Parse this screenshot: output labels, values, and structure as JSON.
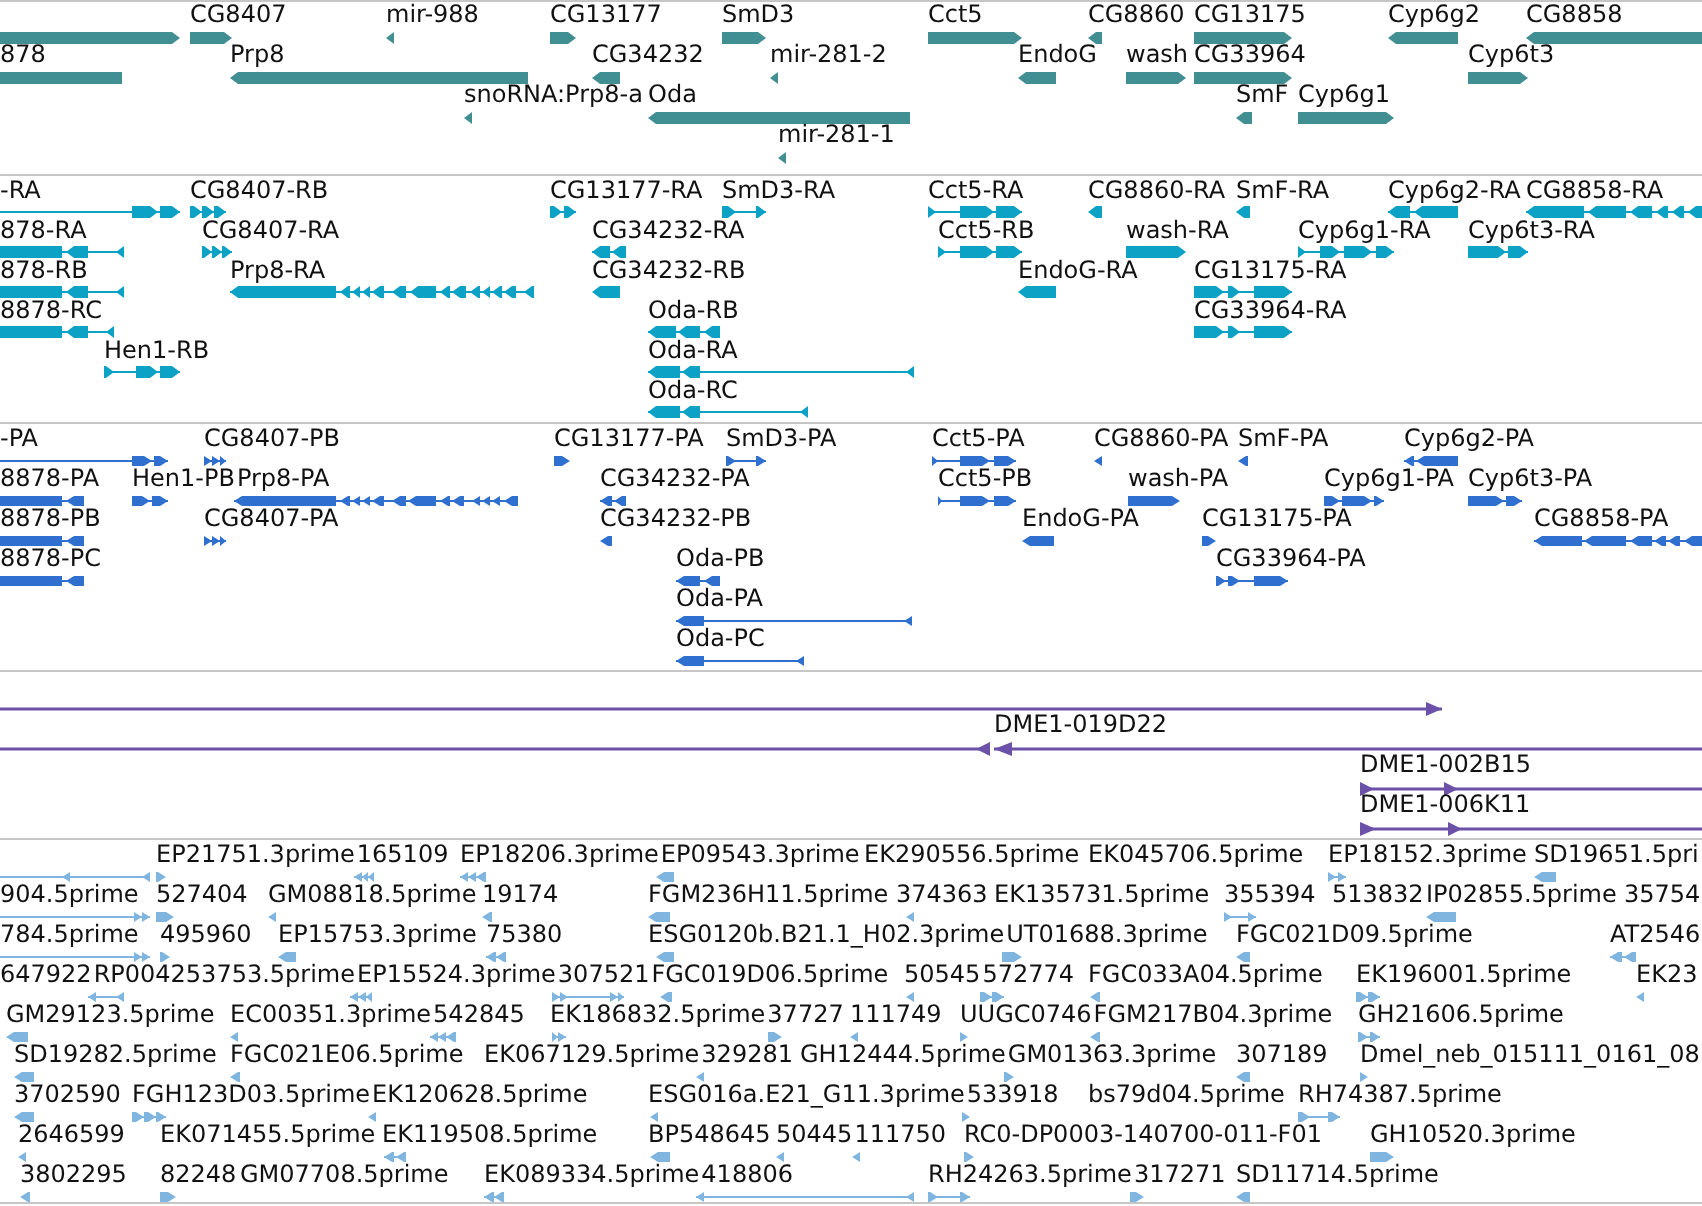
{
  "tracks": [
    {
      "kind": "gene",
      "rows": [
        {
          "features": [
            {
              "reverse": false
            },
            {
              "label": "CG8407",
              "reverse": false
            },
            {
              "label": "mir-988",
              "reverse": true
            },
            {
              "label": "CG13177",
              "reverse": false
            },
            {
              "label": "SmD3",
              "reverse": false
            },
            {
              "label": "Cct5",
              "reverse": false
            },
            {
              "label": "CG8860",
              "reverse": true
            },
            {
              "label": "CG13175",
              "reverse": false
            },
            {
              "label": "Cyp6g2",
              "reverse": true
            },
            {
              "label": "CG8858",
              "reverse": true
            }
          ]
        },
        {
          "features": [
            {
              "label": "878",
              "reverse": true
            },
            {
              "label": "Prp8",
              "reverse": true
            },
            {
              "label": "CG34232",
              "reverse": true
            },
            {
              "label": "mir-281-2",
              "reverse": true
            },
            {
              "label": "EndoG",
              "reverse": true
            },
            {
              "label": "wash",
              "reverse": false
            },
            {
              "label": "CG33964",
              "reverse": false
            },
            {
              "label": "Cyp6t3",
              "reverse": false
            }
          ]
        },
        {
          "features": [
            {
              "label": "snoRNA:Prp8-a",
              "reverse": true
            },
            {
              "label": "Oda",
              "reverse": true
            },
            {
              "label": "SmF",
              "reverse": true
            },
            {
              "label": "Cyp6g1",
              "reverse": false
            }
          ]
        },
        {
          "features": [
            {
              "label": "mir-281-1",
              "reverse": true
            }
          ]
        }
      ]
    },
    {
      "kind": "transcript",
      "rows": [
        {
          "features": [
            {
              "label": "-RA",
              "reverse": false
            },
            {
              "label": "CG8407-RB",
              "reverse": false
            },
            {
              "label": "CG13177-RA",
              "reverse": false
            },
            {
              "label": "SmD3-RA",
              "reverse": false
            },
            {
              "label": "Cct5-RA",
              "reverse": false
            },
            {
              "label": "CG8860-RA",
              "reverse": true
            },
            {
              "label": "SmF-RA",
              "reverse": true
            },
            {
              "label": "Cyp6g2-RA",
              "reverse": true
            },
            {
              "label": "CG8858-RA",
              "reverse": true
            }
          ]
        },
        {
          "features": [
            {
              "label": "878-RA",
              "reverse": true
            },
            {
              "label": "CG8407-RA",
              "reverse": false
            },
            {
              "label": "CG34232-RA",
              "reverse": true
            },
            {
              "label": "Cct5-RB",
              "reverse": false
            },
            {
              "label": "wash-RA",
              "reverse": false
            },
            {
              "label": "Cyp6g1-RA",
              "reverse": false
            },
            {
              "label": "Cyp6t3-RA",
              "reverse": false
            }
          ]
        },
        {
          "features": [
            {
              "label": "878-RB",
              "reverse": true
            },
            {
              "label": "Prp8-RA",
              "reverse": true
            },
            {
              "label": "CG34232-RB",
              "reverse": true
            },
            {
              "label": "EndoG-RA",
              "reverse": true
            },
            {
              "label": "CG13175-RA",
              "reverse": false
            }
          ]
        },
        {
          "features": [
            {
              "label": "8878-RC",
              "reverse": true
            },
            {
              "label": "Oda-RB",
              "reverse": true
            },
            {
              "label": "CG33964-RA",
              "reverse": false
            }
          ]
        },
        {
          "features": [
            {
              "label": "Hen1-RB",
              "reverse": false
            },
            {
              "label": "Oda-RA",
              "reverse": true
            }
          ]
        },
        {
          "features": [
            {
              "label": "Oda-RC",
              "reverse": true
            }
          ]
        }
      ]
    },
    {
      "kind": "protein",
      "rows": [
        {
          "features": [
            {
              "label": "-PA",
              "reverse": false
            },
            {
              "label": "CG8407-PB",
              "reverse": false
            },
            {
              "label": "CG13177-PA",
              "reverse": false
            },
            {
              "label": "SmD3-PA",
              "reverse": false
            },
            {
              "label": "Cct5-PA",
              "reverse": false
            },
            {
              "label": "CG8860-PA",
              "reverse": true
            },
            {
              "label": "SmF-PA",
              "reverse": true
            },
            {
              "label": "Cyp6g2-PA",
              "reverse": true
            }
          ]
        },
        {
          "features": [
            {
              "label": "8878-PA",
              "reverse": true
            },
            {
              "label": "Hen1-PB",
              "reverse": false
            },
            {
              "label": "Prp8-PA",
              "reverse": true
            },
            {
              "label": "CG34232-PA",
              "reverse": true
            },
            {
              "label": "Cct5-PB",
              "reverse": false
            },
            {
              "label": "wash-PA",
              "reverse": false
            },
            {
              "label": "Cyp6g1-PA",
              "reverse": false
            },
            {
              "label": "Cyp6t3-PA",
              "reverse": false
            }
          ]
        },
        {
          "features": [
            {
              "label": "8878-PB",
              "reverse": true
            },
            {
              "label": "CG8407-PA",
              "reverse": false
            },
            {
              "label": "CG34232-PB",
              "reverse": true
            },
            {
              "label": "EndoG-PA",
              "reverse": true
            },
            {
              "label": "CG13175-PA",
              "reverse": false
            },
            {
              "label": "CG8858-PA",
              "reverse": true
            }
          ]
        },
        {
          "features": [
            {
              "label": "8878-PC",
              "reverse": true
            },
            {
              "label": "Oda-PB",
              "reverse": true
            },
            {
              "label": "CG33964-PA",
              "reverse": false
            }
          ]
        },
        {
          "features": [
            {
              "label": "Oda-PA",
              "reverse": true
            }
          ]
        },
        {
          "features": [
            {
              "label": "Oda-PC",
              "reverse": true
            }
          ]
        }
      ]
    },
    {
      "kind": "clone",
      "rows": [
        {
          "features": [
            {
              "reverse": false
            }
          ]
        },
        {
          "features": [
            {
              "reverse": true
            },
            {
              "label": "DME1-019D22",
              "reverse": true
            }
          ]
        },
        {
          "features": [
            {
              "label": "DME1-002B15",
              "reverse": false
            }
          ]
        },
        {
          "features": [
            {
              "label": "DME1-006K11",
              "reverse": false
            }
          ]
        }
      ]
    },
    {
      "kind": "est",
      "rows": [
        {
          "features": [
            {
              "reverse": true
            },
            {
              "label": "EP21751.3prime",
              "reverse": false
            },
            {
              "label": "165109",
              "reverse": true
            },
            {
              "label": "EP18206.3prime",
              "reverse": true
            },
            {
              "label": "EP09543.3prime",
              "reverse": true
            },
            {
              "label": "EK290556.5prime"
            },
            {
              "label": "EK045706.5prime"
            },
            {
              "label": "EP18152.3prime",
              "reverse": false
            },
            {
              "label": "SD19651.5pri",
              "reverse": true
            }
          ]
        },
        {
          "features": [
            {
              "label": "904.5prime",
              "reverse": false
            },
            {
              "label": "527404",
              "reverse": false
            },
            {
              "label": "GM08818.5prime",
              "reverse": true
            },
            {
              "label": "19174",
              "reverse": true
            },
            {
              "label": "FGM236H11.5prime",
              "reverse": true
            },
            {
              "label": "374363",
              "reverse": true
            },
            {
              "label": "EK135731.5prime"
            },
            {
              "label": "355394",
              "reverse": false
            },
            {
              "label": "513832"
            },
            {
              "label": "IP02855.5prime",
              "reverse": true
            },
            {
              "label": "35754"
            }
          ]
        },
        {
          "features": [
            {
              "label": "784.5prime",
              "reverse": false
            },
            {
              "label": "495960",
              "reverse": false
            },
            {
              "label": "EP15753.3prime",
              "reverse": true
            },
            {
              "label": "75380",
              "reverse": true
            },
            {
              "label": "ESG0120b.B21.1_H02.3prime",
              "reverse": true
            },
            {
              "label": "UT01688.3prime",
              "reverse": false
            },
            {
              "label": "FGC021D09.5prime",
              "reverse": true
            },
            {
              "label": "AT2546",
              "reverse": true
            }
          ]
        },
        {
          "features": [
            {
              "label": "647922"
            },
            {
              "label": "RP004253753.5prime",
              "reverse": true
            },
            {
              "label": "EP15524.3prime",
              "reverse": true
            },
            {
              "label": "307521",
              "reverse": false
            },
            {
              "label": "FGC019D06.5prime",
              "reverse": true
            },
            {
              "label": "50545",
              "reverse": true
            },
            {
              "label": "572774",
              "reverse": false
            },
            {
              "label": "FGC033A04.5prime",
              "reverse": true
            },
            {
              "label": "EK196001.5prime",
              "reverse": false
            },
            {
              "label": "EK23",
              "reverse": true
            }
          ]
        },
        {
          "features": [
            {
              "label": "GM29123.5prime",
              "reverse": true
            },
            {
              "label": "EC00351.3prime",
              "reverse": true
            },
            {
              "label": "542845",
              "reverse": true
            },
            {
              "label": "EK186832.5prime",
              "reverse": false
            },
            {
              "label": "37727",
              "reverse": false
            },
            {
              "label": "111749",
              "reverse": true
            },
            {
              "label": "UUGC0746",
              "reverse": false
            },
            {
              "label": "FGM217B04.3prime",
              "reverse": true
            },
            {
              "label": "GH21606.5prime",
              "reverse": false
            }
          ]
        },
        {
          "features": [
            {
              "label": "SD19282.5prime",
              "reverse": true
            },
            {
              "label": "FGC021E06.5prime",
              "reverse": true
            },
            {
              "label": "EK067129.5prime"
            },
            {
              "label": "329281",
              "reverse": true
            },
            {
              "label": "GH12444.5prime"
            },
            {
              "label": "GM01363.3prime",
              "reverse": false
            },
            {
              "label": "307189",
              "reverse": true
            },
            {
              "label": "Dmel_neb_015111_0161_08",
              "reverse": false
            }
          ]
        },
        {
          "features": [
            {
              "label": "3702590",
              "reverse": true
            },
            {
              "label": "FGH123D03.5prime",
              "reverse": false
            },
            {
              "label": "EK120628.5prime",
              "reverse": true
            },
            {
              "label": "ESG016a.E21_G11.3prime",
              "reverse": true
            },
            {
              "label": "533918",
              "reverse": false
            },
            {
              "label": "bs79d04.5prime"
            },
            {
              "label": "RH74387.5prime",
              "reverse": false
            }
          ]
        },
        {
          "features": [
            {
              "label": "2646599",
              "reverse": true
            },
            {
              "label": "EK071455.5prime"
            },
            {
              "label": "EK119508.5prime",
              "reverse": true
            },
            {
              "label": "BP548645",
              "reverse": true
            },
            {
              "label": "50445",
              "reverse": true
            },
            {
              "label": "111750",
              "reverse": true
            },
            {
              "label": "RC0-DP0003-140700-011-F01",
              "reverse": false
            },
            {
              "label": "GH10520.3prime",
              "reverse": false
            }
          ]
        },
        {
          "features": [
            {
              "label": "3802295",
              "reverse": true
            },
            {
              "label": "82248",
              "reverse": false
            },
            {
              "label": "GM07708.5prime"
            },
            {
              "label": "EK089334.5prime",
              "reverse": true
            },
            {
              "label": "418806",
              "reverse": true
            },
            {
              "label": "RH24263.5prime",
              "reverse": false
            },
            {
              "label": "317271",
              "reverse": false
            },
            {
              "label": "SD11714.5prime",
              "reverse": true
            }
          ]
        }
      ]
    }
  ]
}
